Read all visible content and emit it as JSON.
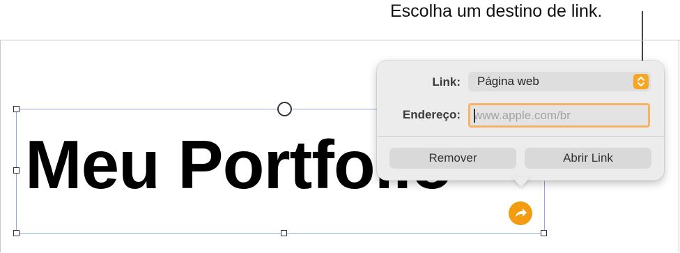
{
  "callout": {
    "text": "Escolha um destino de link."
  },
  "canvas": {
    "headline": "Meu Portfolio"
  },
  "popover": {
    "link_label": "Link:",
    "link_type_value": "Página web",
    "address_label": "Endereço:",
    "address_placeholder": "www.apple.com/br",
    "address_value": "",
    "remove_button": "Remover",
    "open_link_button": "Abrir Link"
  },
  "colors": {
    "accent": "#f5a623",
    "focus_ring": "#f7b267",
    "selection": "#8fa8e8"
  },
  "icons": {
    "stepper": "chevron-up-down-icon",
    "link_badge": "link-arrow-icon"
  }
}
